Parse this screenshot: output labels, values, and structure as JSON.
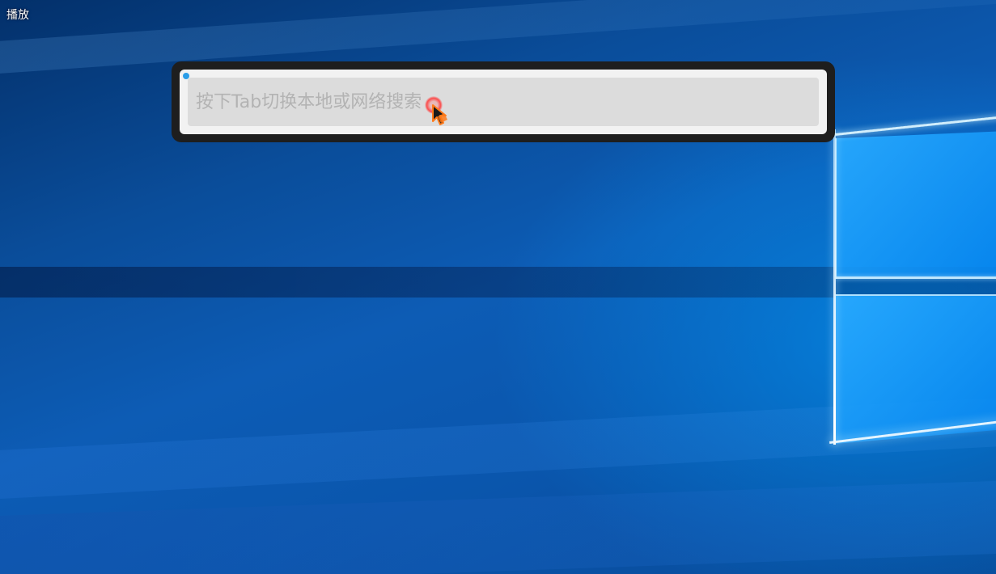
{
  "overlay": {
    "play_label": "播放"
  },
  "search": {
    "placeholder": "按下Tab切换本地或网络搜索",
    "value": ""
  },
  "colors": {
    "status_dot": "#2a9de8",
    "window_frame": "#1e1e1e",
    "click_highlight": "#ff3c3c"
  },
  "icons": {
    "cursor": "mouse-pointer-icon",
    "status": "status-dot-icon"
  }
}
